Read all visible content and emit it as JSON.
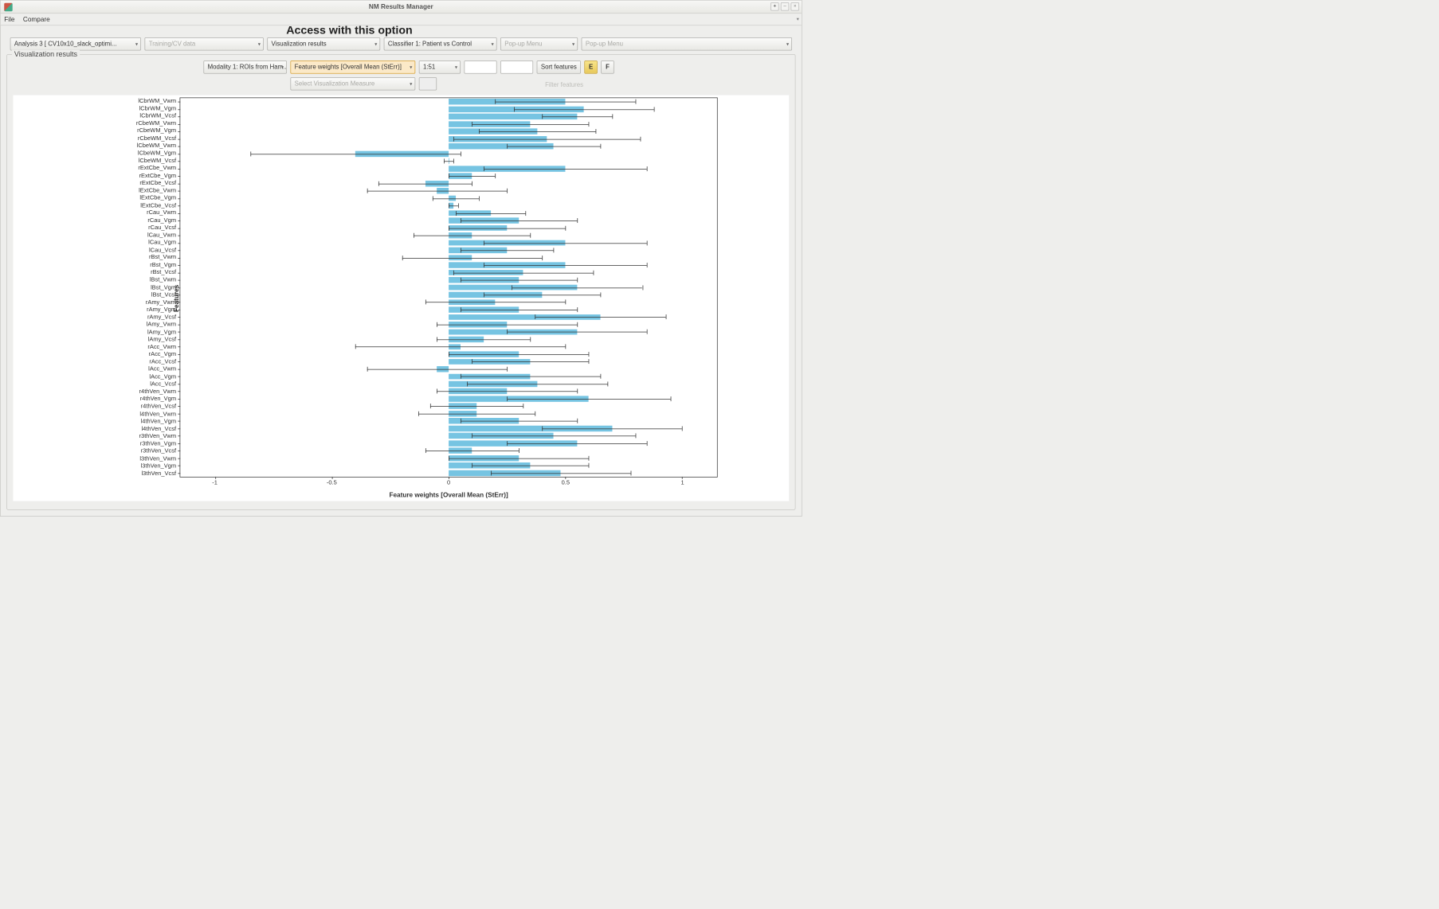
{
  "window": {
    "title": "NM Results Manager"
  },
  "menu": {
    "file": "File",
    "compare": "Compare"
  },
  "banner": "Access with this option",
  "toolbar": {
    "analysis": "Analysis 3 [ CV10x10_slack_optimi...",
    "training": "Training/CV data",
    "viz": "Visualization results",
    "classifier": "Classifier 1: Patient vs Control",
    "popup1": "Pop-up Menu",
    "popup2": "Pop-up Menu"
  },
  "panel": {
    "legend": "Visualization results",
    "modality": "Modality 1: ROIs from Ham...",
    "measure": "Feature weights [Overall Mean (StErr)]",
    "range": "1:51",
    "vizmeasure": "Select Visualization Measure",
    "sort": "Sort features",
    "e": "E",
    "f": "F",
    "filter": "Filter features"
  },
  "chart_data": {
    "type": "bar",
    "orientation": "horizontal",
    "title": "",
    "xlabel": "Feature weights [Overall Mean (StErr)]",
    "ylabel": "Features",
    "xlim": [
      -1.15,
      1.15
    ],
    "xticks": [
      -1,
      -0.5,
      0,
      0.5,
      1
    ],
    "bar_color": "#76c4e2",
    "categories": [
      "lCbrWM_Vwm",
      "lCbrWM_Vgm",
      "lCbrWM_Vcsf",
      "rCbeWM_Vwm",
      "rCbeWM_Vgm",
      "rCbeWM_Vcsf",
      "lCbeWM_Vwm",
      "lCbeWM_Vgm",
      "lCbeWM_Vcsf",
      "rExtCbe_Vwm",
      "rExtCbe_Vgm",
      "rExtCbe_Vcsf",
      "lExtCbe_Vwm",
      "lExtCbe_Vgm",
      "lExtCbe_Vcsf",
      "rCau_Vwm",
      "rCau_Vgm",
      "rCau_Vcsf",
      "lCau_Vwm",
      "lCau_Vgm",
      "lCau_Vcsf",
      "rBst_Vwm",
      "rBst_Vgm",
      "rBst_Vcsf",
      "lBst_Vwm",
      "lBst_Vgm",
      "lBst_Vcsf",
      "rAmy_Vwm",
      "rAmy_Vgm",
      "rAmy_Vcsf",
      "lAmy_Vwm",
      "lAmy_Vgm",
      "lAmy_Vcsf",
      "rAcc_Vwm",
      "rAcc_Vgm",
      "rAcc_Vcsf",
      "lAcc_Vwm",
      "lAcc_Vgm",
      "lAcc_Vcsf",
      "r4thVen_Vwm",
      "r4thVen_Vgm",
      "r4thVen_Vcsf",
      "l4thVen_Vwm",
      "l4thVen_Vgm",
      "l4thVen_Vcsf",
      "r3thVen_Vwm",
      "r3thVen_Vgm",
      "r3thVen_Vcsf",
      "l3thVen_Vwm",
      "l3thVen_Vgm",
      "l3thVen_Vcsf"
    ],
    "values": [
      0.5,
      0.58,
      0.55,
      0.35,
      0.38,
      0.42,
      0.45,
      -0.4,
      0.0,
      0.5,
      0.1,
      -0.1,
      -0.05,
      0.03,
      0.02,
      0.18,
      0.3,
      0.25,
      0.1,
      0.5,
      0.25,
      0.1,
      0.5,
      0.32,
      0.3,
      0.55,
      0.4,
      0.2,
      0.3,
      0.65,
      0.25,
      0.55,
      0.15,
      0.05,
      0.3,
      0.35,
      -0.05,
      0.35,
      0.38,
      0.25,
      0.6,
      0.12,
      0.12,
      0.3,
      0.7,
      0.45,
      0.55,
      0.1,
      0.3,
      0.35,
      0.48
    ],
    "errors": [
      0.3,
      0.3,
      0.15,
      0.25,
      0.25,
      0.4,
      0.2,
      0.45,
      0.02,
      0.35,
      0.1,
      0.2,
      0.3,
      0.1,
      0.02,
      0.15,
      0.25,
      0.25,
      0.25,
      0.35,
      0.2,
      0.3,
      0.35,
      0.3,
      0.25,
      0.28,
      0.25,
      0.3,
      0.25,
      0.28,
      0.3,
      0.3,
      0.2,
      0.45,
      0.3,
      0.25,
      0.3,
      0.3,
      0.3,
      0.3,
      0.35,
      0.2,
      0.25,
      0.25,
      0.3,
      0.35,
      0.3,
      0.2,
      0.3,
      0.25,
      0.3
    ]
  }
}
